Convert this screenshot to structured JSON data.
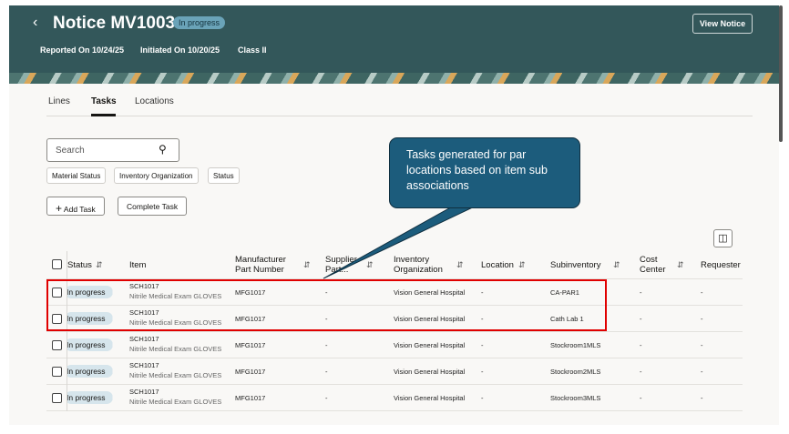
{
  "header": {
    "title": "Notice MV1003",
    "status": "In progress",
    "reported": "Reported On 10/24/25",
    "initiated": "Initiated On 10/20/25",
    "class": "Class II",
    "view_button": "View Notice"
  },
  "tabs": [
    {
      "label": "Lines"
    },
    {
      "label": "Tasks",
      "selected": true
    },
    {
      "label": "Locations"
    }
  ],
  "search": {
    "placeholder": "Search"
  },
  "filters": [
    "Material Status",
    "Inventory Organization",
    "Status"
  ],
  "actions": {
    "add": "Add Task",
    "complete": "Complete Task"
  },
  "columns": [
    "Status",
    "Item",
    "Manufacturer Part Number",
    "Supplier Part...",
    "Inventory Organization",
    "Location",
    "Subinventory",
    "Cost Center",
    "Requester"
  ],
  "rows": [
    {
      "status": "In progress",
      "item": "SCH1017",
      "desc": "Nitrile Medical Exam GLOVES",
      "mfr": "MFG1017",
      "supplier": "-",
      "org": "Vision General Hospital",
      "location": "-",
      "subinv": "CA-PAR1",
      "cost": "-",
      "req": "-"
    },
    {
      "status": "In progress",
      "item": "SCH1017",
      "desc": "Nitrile Medical Exam GLOVES",
      "mfr": "MFG1017",
      "supplier": "-",
      "org": "Vision General Hospital",
      "location": "-",
      "subinv": "Cath Lab 1",
      "cost": "-",
      "req": "-"
    },
    {
      "status": "In progress",
      "item": "SCH1017",
      "desc": "Nitrile Medical Exam GLOVES",
      "mfr": "MFG1017",
      "supplier": "-",
      "org": "Vision General Hospital",
      "location": "-",
      "subinv": "Stockroom1MLS",
      "cost": "-",
      "req": "-"
    },
    {
      "status": "In progress",
      "item": "SCH1017",
      "desc": "Nitrile Medical Exam GLOVES",
      "mfr": "MFG1017",
      "supplier": "-",
      "org": "Vision General Hospital",
      "location": "-",
      "subinv": "Stockroom2MLS",
      "cost": "-",
      "req": "-"
    },
    {
      "status": "In progress",
      "item": "SCH1017",
      "desc": "Nitrile Medical Exam GLOVES",
      "mfr": "MFG1017",
      "supplier": "-",
      "org": "Vision General Hospital",
      "location": "-",
      "subinv": "Stockroom3MLS",
      "cost": "-",
      "req": "-"
    }
  ],
  "callout": "Tasks generated for par locations based on item sub associations",
  "colors": {
    "header": "#33575a",
    "callout": "#1c5c7c",
    "highlight": "#e00000",
    "badge": "#6aa3b8"
  }
}
